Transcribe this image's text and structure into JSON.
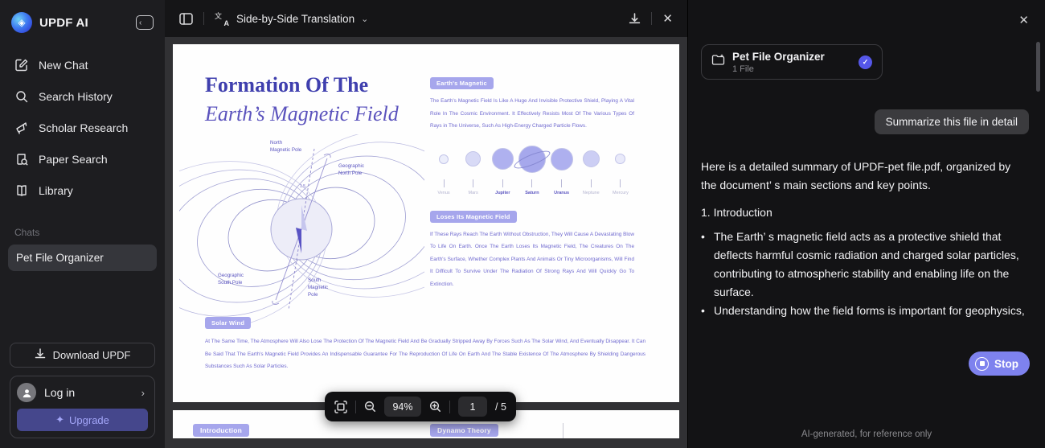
{
  "sidebar": {
    "logo_text": "UPDF AI",
    "nav": [
      {
        "label": "New Chat"
      },
      {
        "label": "Search History"
      },
      {
        "label": "Scholar Research"
      },
      {
        "label": "Paper Search"
      },
      {
        "label": "Library"
      }
    ],
    "chats_label": "Chats",
    "chat_items": [
      {
        "label": "Pet File Organizer"
      }
    ],
    "download_button": "Download UPDF",
    "login_label": "Log in",
    "upgrade_label": "Upgrade",
    "upgrade_icon": "✦",
    "accent_color": "#45478c"
  },
  "viewer": {
    "header": {
      "title": "Side-by-Side Translation"
    },
    "toolbar": {
      "zoom_level": "94%",
      "current_page": "1",
      "page_count": "/ 5"
    },
    "page1": {
      "title_line1": "Formation Of The",
      "title_line2": "Earth’s Magnetic Field",
      "diagram": {
        "north_magnetic_pole": [
          "North",
          "Magnetic Pole"
        ],
        "geographic_north_pole": [
          "Geographic",
          "North Pole"
        ],
        "angle": "1.5",
        "geographic_south_pole": [
          "Geographic",
          "South Pole"
        ],
        "south_magnetic_pole": [
          "South",
          "Magnetic",
          "Pole"
        ]
      },
      "section1_badge": "Earth's Magnetic",
      "section1_text": "The Earth's Magnetic Field Is Like A Huge And Invisible Protective Shield, Playing A Vital Role In The Cosmic Environment. It Effectively Resists Most Of The Various Types Of Rays in The Universe, Such As High-Energy Charged Particle Flows.",
      "planets": [
        {
          "name": "Venus"
        },
        {
          "name": "Mars"
        },
        {
          "name": "Jupiter"
        },
        {
          "name": "Saturn"
        },
        {
          "name": "Uranus"
        },
        {
          "name": "Neptune"
        },
        {
          "name": "Mercury"
        }
      ],
      "section2_badge": "Loses Its Magnetic Field",
      "section2_text": "If These Rays Reach The Earth Without Obstruction, They Will Cause A Devastating Blow To Life On Earth. Once The Earth Loses Its Magnetic Field, The Creatures On The Earth's Surface, Whether Complex Plants And Animals Or Tiny Microorganisms, Will Find It Difficult To Survive Under The Radiation Of Strong Rays And Will Quickly Go To Extinction.",
      "section3_badge": "Solar Wind",
      "section3_text": "At The Same Time, The Atmosphere Will Also Lose The Protection Of The Magnetic Field And Be Gradually Stripped Away By Forces Such As The Solar Wind, And Eventually Disappear. It Can Be Said That The Earth's Magnetic Field Provides An Indispensable Guarantee For The Reproduction Of Life On Earth And The Stable Existence Of The Atmosphere By Shielding Dangerous Substances Such As Solar Particles."
    },
    "page2": {
      "badge1": "Introduction",
      "badge2": "Dynamo Theory"
    }
  },
  "chat_panel": {
    "file_card": {
      "title": "Pet File Organizer",
      "subtitle": "1 File"
    },
    "user_message": "Summarize this file in detail",
    "ai_intro": "Here is a detailed summary of UPDF-pet file.pdf, organized by the document’ s main sections and key points.",
    "ai_section_title": "1. Introduction",
    "ai_bullets": [
      "The Earth’ s magnetic field acts as a protective shield that deflects harmful cosmic radiation and charged solar particles, contributing to atmospheric stability and enabling life on the surface.",
      "Understanding how the field forms is important for geophysics,"
    ],
    "stop_label": "Stop",
    "footer": "AI-generated, for reference only",
    "stop_color": "#7e82ee"
  }
}
